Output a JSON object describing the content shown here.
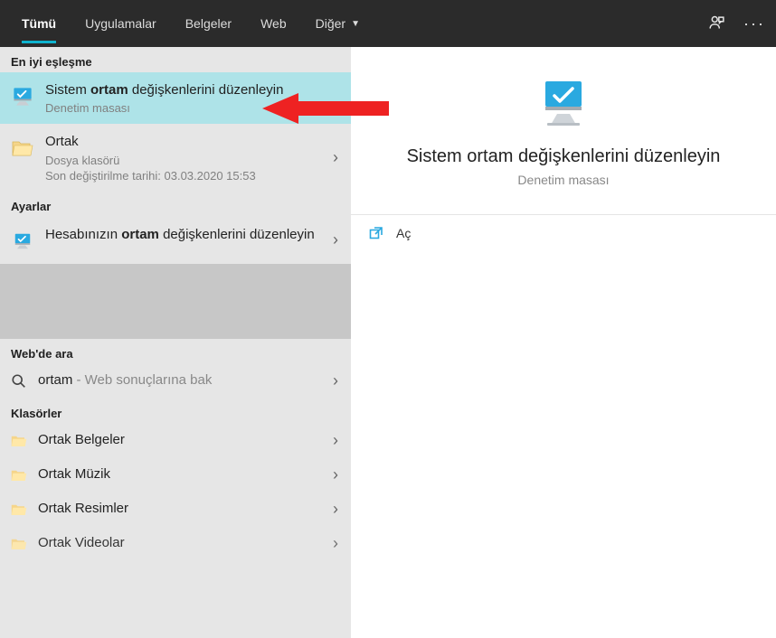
{
  "topbar": {
    "tabs": [
      "Tümü",
      "Uygulamalar",
      "Belgeler",
      "Web",
      "Diğer"
    ],
    "active_index": 0
  },
  "left": {
    "best_match_header": "En iyi eşleşme",
    "best_match": {
      "title_pre": "Sistem ",
      "title_bold": "ortam",
      "title_post": " değişkenlerini düzenleyin",
      "sub": "Denetim masası"
    },
    "ortak_item": {
      "title": "Ortak",
      "sub": "Dosya klasörü",
      "sub2": "Son değiştirilme tarihi: 03.03.2020 15:53"
    },
    "settings_header": "Ayarlar",
    "settings_item": {
      "title_pre": "Hesabınızın ",
      "title_bold": "ortam",
      "title_post": " değişkenlerini düzenleyin"
    },
    "web_header": "Web'de ara",
    "web_item": {
      "term": "ortam",
      "suffix": " - Web sonuçlarına bak"
    },
    "folders_header": "Klasörler",
    "folders": [
      "Ortak Belgeler",
      "Ortak Müzik",
      "Ortak Resimler",
      "Ortak Videolar"
    ]
  },
  "detail": {
    "title": "Sistem ortam değişkenlerini düzenleyin",
    "sub": "Denetim masası",
    "open_label": "Aç"
  }
}
